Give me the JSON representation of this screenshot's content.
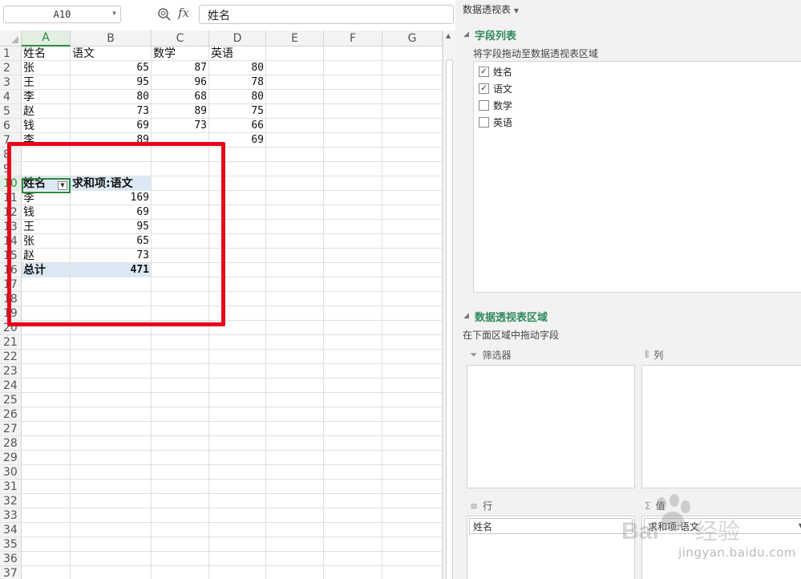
{
  "formula_bar": {
    "name_box": "A10",
    "fx_label": "fx",
    "formula_value": "姓名"
  },
  "columns": [
    "A",
    "B",
    "C",
    "D",
    "E",
    "F",
    "G"
  ],
  "rows": [
    "1",
    "2",
    "3",
    "4",
    "5",
    "6",
    "7",
    "8",
    "9",
    "10",
    "11",
    "12",
    "13",
    "14",
    "15",
    "16",
    "17",
    "18",
    "19",
    "20",
    "21",
    "22",
    "23",
    "24",
    "25",
    "26",
    "27",
    "28",
    "29",
    "30",
    "31",
    "32",
    "33",
    "34",
    "35",
    "36",
    "37"
  ],
  "selected_cell": "A10",
  "source_table": {
    "headers": [
      "姓名",
      "语文",
      "数学",
      "英语"
    ],
    "rows": [
      [
        "张",
        "65",
        "87",
        "80"
      ],
      [
        "王",
        "95",
        "96",
        "78"
      ],
      [
        "李",
        "80",
        "68",
        "80"
      ],
      [
        "赵",
        "73",
        "89",
        "75"
      ],
      [
        "钱",
        "69",
        "73",
        "66"
      ],
      [
        "李",
        "89",
        "",
        "69"
      ]
    ]
  },
  "pivot": {
    "row_header": "姓名",
    "value_header": "求和项:语文",
    "rows": [
      [
        "李",
        "169"
      ],
      [
        "钱",
        "69"
      ],
      [
        "王",
        "95"
      ],
      [
        "张",
        "65"
      ],
      [
        "赵",
        "73"
      ]
    ],
    "total_label": "总计",
    "total_value": "471"
  },
  "pane": {
    "title": "数据透视表",
    "field_list_title": "字段列表",
    "field_list_hint": "将字段拖动至数据透视表区域",
    "fields": [
      {
        "label": "姓名",
        "checked": "✓"
      },
      {
        "label": "语文",
        "checked": "✓"
      },
      {
        "label": "数学",
        "checked": ""
      },
      {
        "label": "英语",
        "checked": ""
      }
    ],
    "areas_title": "数据透视表区域",
    "areas_hint": "在下面区域中拖动字段",
    "filter_label": "筛选器",
    "columns_label": "列",
    "rows_label": "行",
    "values_label": "值",
    "rows_chip": "姓名",
    "values_chip": "求和项:语文"
  },
  "watermark": {
    "logo_text": "Bai 经验",
    "url": "jingyan.baidu.com"
  },
  "colors": {
    "accent_green": "#2c8a3a",
    "pane_green": "#2f8a5b",
    "highlight_red": "#e6081a",
    "pivot_fill": "#dce9f4"
  }
}
